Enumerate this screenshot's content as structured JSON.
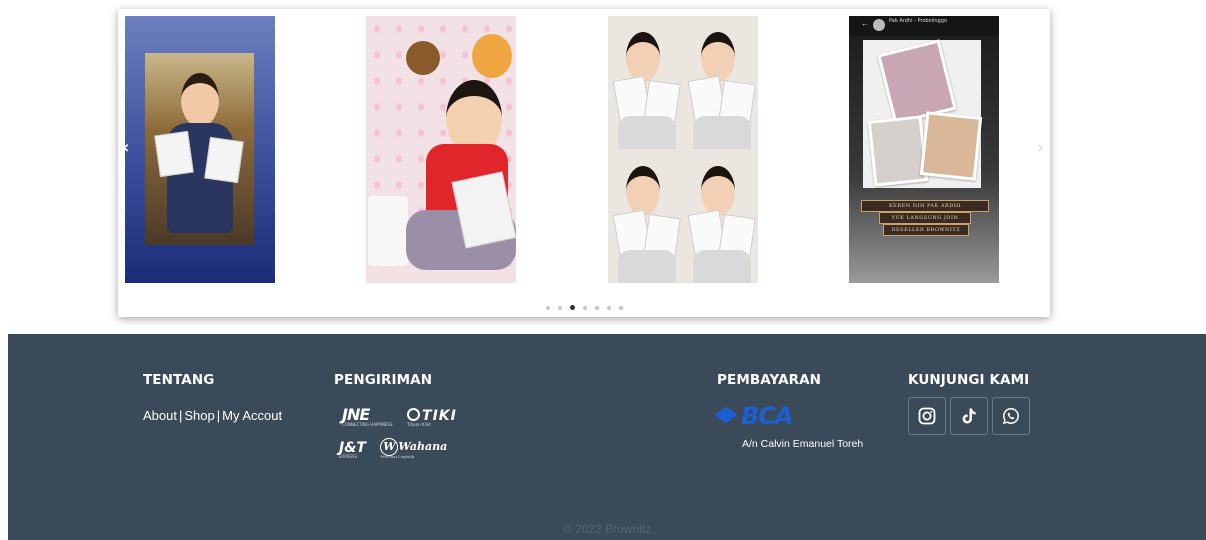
{
  "carousel": {
    "prev_icon": "chevron-left-icon",
    "next_icon": "chevron-right-icon",
    "prev_glyph": "‹",
    "next_glyph": "›",
    "dot_count": 7,
    "active_dot_index": 2,
    "slides": [
      {
        "icon": "photo-girl-trophy"
      },
      {
        "icon": "photo-child-red-shirt"
      },
      {
        "icon": "photo-collage-girl"
      },
      {
        "icon": "photo-story-screenshot",
        "story_header": "Pak Ardhi - Probolinggo",
        "banner_lines": [
          "KEREN NIH PAK ARDHI",
          "YUK LANGSUNG JOIN",
          "RESELLER BROWNITZ"
        ]
      }
    ]
  },
  "footer": {
    "background": "#3b4a58",
    "tentang": {
      "title": "TENTANG",
      "links": [
        "About",
        "Shop",
        "My Accout"
      ],
      "separator": "|"
    },
    "pengiriman": {
      "title": "PENGIRIMAN",
      "couriers": [
        "JNE",
        "TIKI",
        "J&T",
        "Wahana"
      ],
      "courier_taglines": {
        "JNE": "CONNECTING HAPPINESS",
        "TIKI": "Titipan Kilat",
        "J&T": "EXPRESS",
        "Wahana": "Prestasi Logistik"
      }
    },
    "pembayaran": {
      "title": "PEMBAYARAN",
      "bank": "BCA",
      "bank_color": "#1b5fd6",
      "account_holder": "A/n Calvin Emanuel Toreh"
    },
    "kunjungi": {
      "title": "KUNJUNGI KAMI",
      "social": [
        {
          "icon": "instagram-icon",
          "label": "Instagram"
        },
        {
          "icon": "tiktok-icon",
          "label": "TikTok"
        },
        {
          "icon": "whatsapp-icon",
          "label": "WhatsApp"
        }
      ]
    },
    "copyright": "© 2022 Brownitz"
  }
}
